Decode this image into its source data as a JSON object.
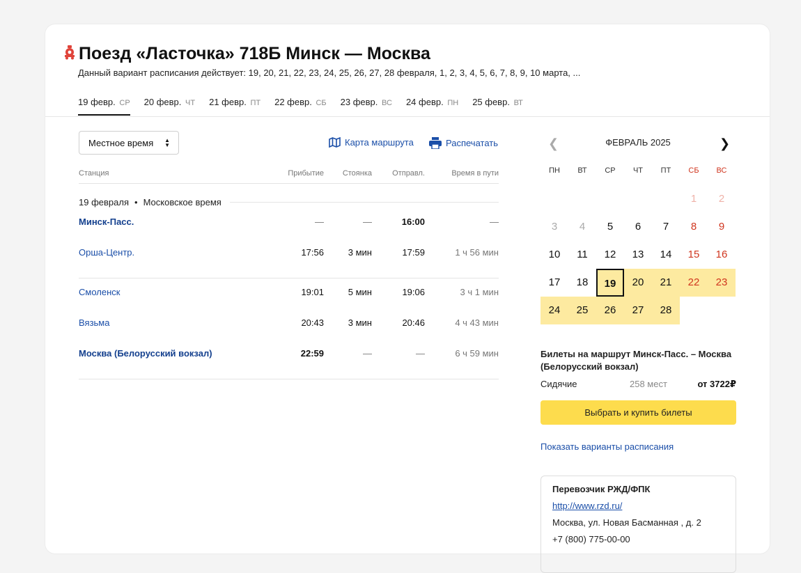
{
  "header": {
    "title": "Поезд «Ласточка» 718Б Минск — Москва",
    "subtitle": "Данный вариант расписания действует: 19, 20, 21, 22, 23, 24, 25, 26, 27, 28 февраля, 1, 2, 3, 4, 5, 6, 7, 8, 9, 10 марта, ..."
  },
  "tabs": [
    {
      "date": "19 февр.",
      "weekday": "СР",
      "active": true
    },
    {
      "date": "20 февр.",
      "weekday": "ЧТ"
    },
    {
      "date": "21 февр.",
      "weekday": "ПТ"
    },
    {
      "date": "22 февр.",
      "weekday": "СБ"
    },
    {
      "date": "23 февр.",
      "weekday": "ВС"
    },
    {
      "date": "24 февр.",
      "weekday": "ПН"
    },
    {
      "date": "25 февр.",
      "weekday": "ВТ"
    }
  ],
  "timezone_select": {
    "value": "Местное время"
  },
  "actions": {
    "map": "Карта маршрута",
    "print": "Распечатать"
  },
  "table": {
    "headers": {
      "station": "Станция",
      "arrival": "Прибытие",
      "stop": "Стоянка",
      "departure": "Отправл.",
      "travel": "Время в пути"
    },
    "date_label": "19 февраля",
    "time_label": "Московское время",
    "rows": [
      {
        "station": "Минск-Пасс.",
        "arrival": "—",
        "stop": "—",
        "departure": "16:00",
        "travel": "—"
      },
      {
        "station": "Орша-Центр.",
        "arrival": "17:56",
        "stop": "3 мин",
        "departure": "17:59",
        "travel": "1 ч 56 мин"
      },
      {
        "station": "Смоленск",
        "arrival": "19:01",
        "stop": "5 мин",
        "departure": "19:06",
        "travel": "3 ч 1 мин"
      },
      {
        "station": "Вязьма",
        "arrival": "20:43",
        "stop": "3 мин",
        "departure": "20:46",
        "travel": "4 ч 43 мин"
      },
      {
        "station": "Москва (Белорусский вокзал)",
        "arrival": "22:59",
        "stop": "—",
        "departure": "—",
        "travel": "6 ч 59 мин"
      }
    ]
  },
  "calendar": {
    "month": "ФЕВРАЛЬ 2025",
    "prev_icon": "chevron-left-icon",
    "next_icon": "chevron-right-icon",
    "weekdays": [
      "ПН",
      "ВТ",
      "СР",
      "ЧТ",
      "ПТ",
      "СБ",
      "ВС"
    ],
    "days": [
      "1",
      "2",
      "3",
      "4",
      "5",
      "6",
      "7",
      "8",
      "9",
      "10",
      "11",
      "12",
      "13",
      "14",
      "15",
      "16",
      "17",
      "18",
      "19",
      "20",
      "21",
      "22",
      "23",
      "24",
      "25",
      "26",
      "27",
      "28"
    ],
    "selected": "19"
  },
  "tickets": {
    "title": "Билеты на маршрут Минск-Пасс. – Москва (Белорусский вокзал)",
    "class": "Сидячие",
    "seats": "258 мест",
    "price": "от 3722₽",
    "buy_label": "Выбрать и купить билеты",
    "variants_link": "Показать варианты расписания"
  },
  "carrier": {
    "title": "Перевозчик РЖД/ФПК",
    "url": "http://www.rzd.ru/",
    "address": "Москва, ул. Новая Басманная , д. 2",
    "phone": "+7 (800) 775-00-00"
  },
  "colors": {
    "accent_link": "#1a4ea8",
    "highlight": "#fdeaa0",
    "button": "#fddc4d",
    "weekend": "#d0361f"
  }
}
